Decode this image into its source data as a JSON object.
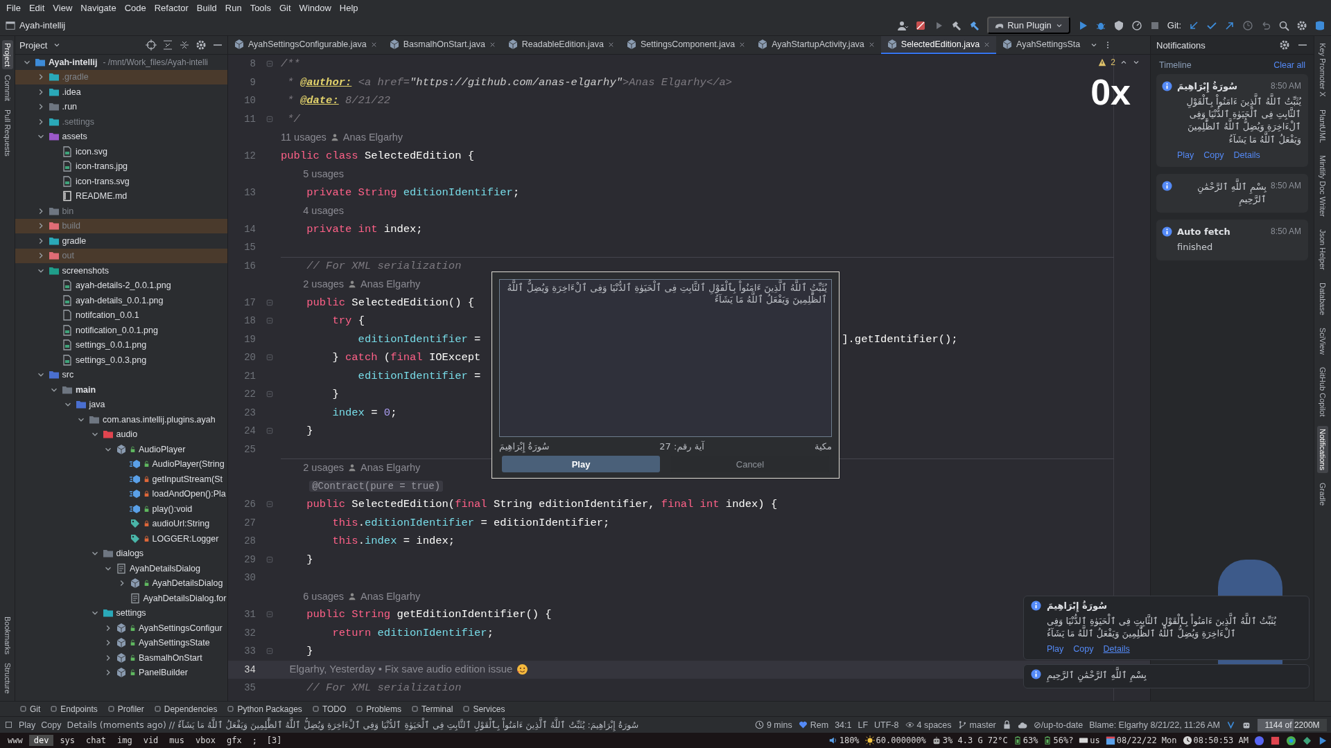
{
  "menu": [
    "File",
    "Edit",
    "View",
    "Navigate",
    "Code",
    "Refactor",
    "Build",
    "Run",
    "Tools",
    "Git",
    "Window",
    "Help"
  ],
  "toolbar": {
    "project": "Ayah-intellij",
    "run_config": "Run Plugin",
    "git_label": "Git:"
  },
  "left_tools": [
    {
      "label": "Project",
      "selected": true
    },
    {
      "label": "Commit",
      "selected": false
    },
    {
      "label": "Pull Requests",
      "selected": false
    }
  ],
  "left_tools_bottom": [
    {
      "label": "Bookmarks",
      "selected": false
    },
    {
      "label": "Structure",
      "selected": false
    }
  ],
  "project_panel": {
    "title": "Project",
    "tree": [
      {
        "label": "Ayah-intellij",
        "detail": "- /mnt/Work_files/Ayah-intelli",
        "kind": "module",
        "expanded": true,
        "children": [
          {
            "label": ".gradle",
            "kind": "excluded-config-folder",
            "expanded": false
          },
          {
            "label": ".idea",
            "kind": "config-folder",
            "expanded": false
          },
          {
            "label": ".run",
            "kind": "folder",
            "expanded": false
          },
          {
            "label": ".settings",
            "kind": "hidden-config-folder",
            "expanded": false
          },
          {
            "label": "assets",
            "kind": "resources-folder",
            "expanded": true,
            "children": [
              {
                "label": "icon.svg",
                "kind": "image-file"
              },
              {
                "label": "icon-trans.jpg",
                "kind": "image-file"
              },
              {
                "label": "icon-trans.svg",
                "kind": "image-file"
              },
              {
                "label": "README.md",
                "kind": "readme-file"
              }
            ]
          },
          {
            "label": "bin",
            "kind": "hidden-folder",
            "expanded": false
          },
          {
            "label": "build",
            "kind": "excluded-folder",
            "expanded": false
          },
          {
            "label": "gradle",
            "kind": "config-folder",
            "expanded": false
          },
          {
            "label": "out",
            "kind": "excluded-folder",
            "expanded": false
          },
          {
            "label": "screenshots",
            "kind": "images-folder",
            "expanded": true,
            "children": [
              {
                "label": "ayah-details-2_0.0.1.png",
                "kind": "image-file"
              },
              {
                "label": "ayah-details_0.0.1.png",
                "kind": "image-file"
              },
              {
                "label": "notifcation_0.0.1",
                "kind": "file"
              },
              {
                "label": "notification_0.0.1.png",
                "kind": "image-file"
              },
              {
                "label": "settings_0.0.1.png",
                "kind": "image-file"
              },
              {
                "label": "settings_0.0.3.png",
                "kind": "image-file"
              }
            ]
          },
          {
            "label": "src",
            "kind": "source-folder",
            "expanded": true,
            "children": [
              {
                "label": "main",
                "kind": "main-folder",
                "expanded": true,
                "children": [
                  {
                    "label": "java",
                    "kind": "java-folder",
                    "expanded": true,
                    "children": [
                      {
                        "label": "com.anas.intellij.plugins.ayah",
                        "kind": "package",
                        "expanded": true,
                        "children": [
                          {
                            "label": "audio",
                            "kind": "audio-package",
                            "expanded": true,
                            "children": [
                              {
                                "label": "AudioPlayer",
                                "kind": "class",
                                "private": false,
                                "expanded": true,
                                "children": [
                                  {
                                    "label": "AudioPlayer(String",
                                    "kind": "method",
                                    "private": false
                                  },
                                  {
                                    "label": "getInputStream(St",
                                    "kind": "method",
                                    "private": true
                                  },
                                  {
                                    "label": "loadAndOpen():Pla",
                                    "kind": "method",
                                    "private": true
                                  },
                                  {
                                    "label": "play():void",
                                    "kind": "method",
                                    "private": false
                                  },
                                  {
                                    "label": "audioUrl:String",
                                    "kind": "field",
                                    "private": true
                                  },
                                  {
                                    "label": "LOGGER:Logger",
                                    "kind": "field",
                                    "private": true
                                  }
                                ]
                              }
                            ]
                          },
                          {
                            "label": "dialogs",
                            "kind": "package",
                            "expanded": true,
                            "children": [
                              {
                                "label": "AyahDetailsDialog",
                                "kind": "form-group",
                                "expanded": true,
                                "children": [
                                  {
                                    "label": "AyahDetailsDialog",
                                    "kind": "class",
                                    "private": false,
                                    "expanded": false
                                  },
                                  {
                                    "label": "AyahDetailsDialog.for",
                                    "kind": "form-file"
                                  }
                                ]
                              }
                            ]
                          },
                          {
                            "label": "settings",
                            "kind": "settings-package",
                            "expanded": true,
                            "children": [
                              {
                                "label": "AyahSettingsConfigur",
                                "kind": "class",
                                "private": false,
                                "expanded": false
                              },
                              {
                                "label": "AyahSettingsState",
                                "kind": "class",
                                "private": false,
                                "expanded": false
                              },
                              {
                                "label": "BasmalhOnStart",
                                "kind": "class",
                                "private": false,
                                "expanded": false
                              },
                              {
                                "label": "PanelBuilder",
                                "kind": "class",
                                "private": false,
                                "expanded": false
                              }
                            ]
                          }
                        ]
                      }
                    ]
                  }
                ]
              }
            ]
          }
        ]
      }
    ]
  },
  "editor": {
    "tabs": [
      {
        "label": "AyahSettingsConfigurable.java",
        "selected": false,
        "closable": true
      },
      {
        "label": "BasmalhOnStart.java",
        "selected": false,
        "closable": true
      },
      {
        "label": "ReadableEdition.java",
        "selected": false,
        "closable": true
      },
      {
        "label": "SettingsComponent.java",
        "selected": false,
        "closable": true
      },
      {
        "label": "AyahStartupActivity.java",
        "selected": false,
        "closable": true
      },
      {
        "label": "SelectedEdition.java",
        "selected": true,
        "closable": true
      },
      {
        "label": "AyahSettingsSta",
        "selected": false,
        "closable": false
      }
    ],
    "warnings": "2",
    "overlay_text": "0x",
    "lines": [
      {
        "kind": "code",
        "number": "8",
        "fold": true,
        "current": false,
        "tokens": [
          {
            "kind": "comment",
            "text": "/**"
          }
        ]
      },
      {
        "kind": "code",
        "number": "9",
        "current": false,
        "tokens": [
          {
            "kind": "comment",
            "text": " * "
          },
          {
            "kind": "doctag",
            "text": "@author:"
          },
          {
            "kind": "comment",
            "text": " <a href="
          },
          {
            "kind": "docstr",
            "text": "\"https://github.com/anas-elgarhy\""
          },
          {
            "kind": "comment",
            "text": ">Anas Elgarhy</a>"
          }
        ]
      },
      {
        "kind": "code",
        "number": "10",
        "current": false,
        "tokens": [
          {
            "kind": "comment",
            "text": " * "
          },
          {
            "kind": "doctag",
            "text": "@date:"
          },
          {
            "kind": "comment",
            "text": " 8/21/22"
          }
        ]
      },
      {
        "kind": "code",
        "number": "11",
        "fold": true,
        "current": false,
        "tokens": [
          {
            "kind": "comment",
            "text": " */"
          }
        ]
      },
      {
        "kind": "hint",
        "usages": "11 usages",
        "author": "Anas Elgarhy"
      },
      {
        "kind": "code",
        "number": "12",
        "current": false,
        "tokens": [
          {
            "kind": "kw",
            "text": "public class "
          },
          {
            "kind": "plain",
            "text": "SelectedEdition {"
          }
        ]
      },
      {
        "kind": "hint",
        "usages": "5 usages"
      },
      {
        "kind": "code",
        "number": "13",
        "current": false,
        "tokens": [
          {
            "kind": "kw",
            "text": "    private String "
          },
          {
            "kind": "field",
            "text": "editionIdentifier"
          },
          {
            "kind": "plain",
            "text": ";"
          }
        ]
      },
      {
        "kind": "hint",
        "usages": "4 usages"
      },
      {
        "kind": "code",
        "number": "14",
        "current": false,
        "tokens": [
          {
            "kind": "kw",
            "text": "    private int "
          },
          {
            "kind": "plain",
            "text": "index;"
          }
        ]
      },
      {
        "kind": "code",
        "number": "15",
        "current": false
      },
      {
        "kind": "code",
        "number": "16",
        "separator": true,
        "current": false,
        "tokens": [
          {
            "kind": "comment",
            "text": "    // For XML serialization"
          }
        ]
      },
      {
        "kind": "hint",
        "usages": "2 usages",
        "author": "Anas Elgarhy"
      },
      {
        "kind": "code",
        "number": "17",
        "fold": true,
        "current": false,
        "tokens": [
          {
            "kind": "kw",
            "text": "    public "
          },
          {
            "kind": "plain",
            "text": "SelectedEdition() {"
          }
        ]
      },
      {
        "kind": "code",
        "number": "18",
        "fold": true,
        "current": false,
        "tokens": [
          {
            "kind": "kw",
            "text": "        try"
          },
          {
            "kind": "plain",
            "text": " {"
          }
        ]
      },
      {
        "kind": "code",
        "number": "19",
        "current": false,
        "tokens": [
          {
            "kind": "field",
            "text": "            editionIdentifier"
          },
          {
            "kind": "plain",
            "text": " ="
          },
          {
            "kind": "gap"
          },
          {
            "kind": "plain",
            "text": "].getIdentifier();"
          }
        ]
      },
      {
        "kind": "code",
        "number": "20",
        "fold": true,
        "current": false,
        "tokens": [
          {
            "kind": "plain",
            "text": "        } "
          },
          {
            "kind": "kw",
            "text": "catch"
          },
          {
            "kind": "plain",
            "text": " ("
          },
          {
            "kind": "kw",
            "text": "final "
          },
          {
            "kind": "plain",
            "text": "IOExcept"
          }
        ]
      },
      {
        "kind": "code",
        "number": "21",
        "current": false,
        "tokens": [
          {
            "kind": "field",
            "text": "            editionIdentifier"
          },
          {
            "kind": "plain",
            "text": " ="
          }
        ]
      },
      {
        "kind": "code",
        "number": "22",
        "fold": true,
        "current": false,
        "tokens": [
          {
            "kind": "plain",
            "text": "        }"
          }
        ]
      },
      {
        "kind": "code",
        "number": "23",
        "current": false,
        "tokens": [
          {
            "kind": "field",
            "text": "        index"
          },
          {
            "kind": "plain",
            "text": " = "
          },
          {
            "kind": "num",
            "text": "0"
          },
          {
            "kind": "plain",
            "text": ";"
          }
        ]
      },
      {
        "kind": "code",
        "number": "24",
        "fold": true,
        "current": false,
        "tokens": [
          {
            "kind": "plain",
            "text": "    }"
          }
        ]
      },
      {
        "kind": "code",
        "number": "25",
        "current": false
      },
      {
        "kind": "hint",
        "separator": true,
        "usages": "2 usages",
        "author": "Anas Elgarhy"
      },
      {
        "kind": "annotation",
        "text": "@Contract(pure = true)"
      },
      {
        "kind": "code",
        "number": "26",
        "fold": true,
        "current": false,
        "tokens": [
          {
            "kind": "kw",
            "text": "    public "
          },
          {
            "kind": "plain",
            "text": "SelectedEdition("
          },
          {
            "kind": "kw",
            "text": "final "
          },
          {
            "kind": "plain",
            "text": "String editionIdentifier, "
          },
          {
            "kind": "kw",
            "text": "final int "
          },
          {
            "kind": "plain",
            "text": "index) {"
          }
        ]
      },
      {
        "kind": "code",
        "number": "27",
        "current": false,
        "tokens": [
          {
            "kind": "kw",
            "text": "        this"
          },
          {
            "kind": "plain",
            "text": "."
          },
          {
            "kind": "field",
            "text": "editionIdentifier"
          },
          {
            "kind": "plain",
            "text": " = editionIdentifier;"
          }
        ]
      },
      {
        "kind": "code",
        "number": "28",
        "current": false,
        "tokens": [
          {
            "kind": "kw",
            "text": "        this"
          },
          {
            "kind": "plain",
            "text": "."
          },
          {
            "kind": "field",
            "text": "index"
          },
          {
            "kind": "plain",
            "text": " = index;"
          }
        ]
      },
      {
        "kind": "code",
        "number": "29",
        "fold": true,
        "current": false,
        "tokens": [
          {
            "kind": "plain",
            "text": "    }"
          }
        ]
      },
      {
        "kind": "code",
        "number": "30",
        "current": false
      },
      {
        "kind": "hint",
        "usages": "6 usages",
        "author": "Anas Elgarhy"
      },
      {
        "kind": "code",
        "number": "31",
        "fold": true,
        "current": false,
        "tokens": [
          {
            "kind": "kw",
            "text": "    public String "
          },
          {
            "kind": "plain",
            "text": "getEditionIdentifier() {"
          }
        ]
      },
      {
        "kind": "code",
        "number": "32",
        "current": false,
        "tokens": [
          {
            "kind": "kw",
            "text": "        return "
          },
          {
            "kind": "field",
            "text": "editionIdentifier"
          },
          {
            "kind": "plain",
            "text": ";"
          }
        ]
      },
      {
        "kind": "code",
        "number": "33",
        "fold": true,
        "current": false,
        "tokens": [
          {
            "kind": "plain",
            "text": "    }"
          }
        ]
      },
      {
        "kind": "code",
        "number": "34",
        "current": true,
        "tokens": [
          {
            "kind": "blame",
            "text": "   Elgarhy, Yesterday • Fix save audio edition issue"
          }
        ]
      },
      {
        "kind": "code",
        "number": "35",
        "current": false,
        "tokens": [
          {
            "kind": "comment",
            "text": "    // For XML serialization"
          }
        ]
      }
    ],
    "dialog": {
      "text": "يُثَبِّتُ ٱللَّهُ ٱلَّذِينَ ءَامَنُواْ بِٱلْقَوْلِ ٱلثَّابِتِ فِى ٱلْحَيَوٰةِ ٱلدُّنْيَا وَفِى ٱلْءَاخِرَةِ وَيُضِلُّ ٱللَّهُ ٱلظَّٰلِمِينَ وَيَفْعَلُ ٱللَّهُ مَا يَشَآءُ",
      "surah": "سُورَةُ إِبْرَاهِيمَ",
      "ayah_number": "آية رقم: 27",
      "revelation": "مكية",
      "buttons": [
        {
          "label": "Play",
          "selected": true
        },
        {
          "label": "Cancel",
          "selected": false
        }
      ]
    }
  },
  "notifications": {
    "title": "Notifications",
    "timeline": "Timeline",
    "clear": "Clear all",
    "items": [
      {
        "title": "سُورَةُ إِبْرَاهِيمَ",
        "time": "8:50 AM",
        "body": "يُثَبِّتُ ٱللَّهُ ٱلَّذِينَ ءَامَنُواْ بِٱلْقَوْلِ ٱلثَّابِتِ فِى ٱلْحَيَوٰةِ ٱلدُّنْيَا وَفِى ٱلْءَاخِرَةِ وَيُضِلُّ ٱللَّهُ ٱلظَّٰلِمِينَ وَيَفْعَلُ ٱللَّهُ مَا يَشَآءُ",
        "actions": [
          "Play",
          "Copy",
          "Details"
        ]
      },
      {
        "time": "8:50 AM",
        "body": "بِسْمِ ٱللَّهِ ٱلرَّحْمَٰنِ ٱلرَّحِيمِ"
      },
      {
        "title": "Auto fetch",
        "time": "8:50 AM",
        "body": "finished"
      }
    ]
  },
  "right_tools": [
    {
      "label": "Key Promoter X",
      "selected": false
    },
    {
      "label": "PlantUML",
      "selected": false
    },
    {
      "label": "Mintlify Doc Writer",
      "selected": false
    },
    {
      "label": "Json Helper",
      "selected": false
    },
    {
      "label": "Database",
      "selected": false
    },
    {
      "label": "SciView",
      "selected": false
    },
    {
      "label": "GitHub Copilot",
      "selected": false
    },
    {
      "label": "Notifications",
      "selected": true
    },
    {
      "label": "Gradle",
      "selected": false
    }
  ],
  "balloons": [
    {
      "title": "سُورَةُ إِبْرَاهِيمَ",
      "body": "يُثَبِّتُ ٱللَّهُ ٱلَّذِينَ ءَامَنُواْ بِٱلْقَوْلِ ٱلثَّابِتِ فِى ٱلْحَيَوٰةِ ٱلدُّنْيَا وَفِى ٱلْءَاخِرَةِ وَيُضِلُّ ٱللَّهُ ٱلظَّٰلِمِينَ وَيَفْعَلُ ٱللَّهُ مَا يَشَآءُ",
      "actions": [
        {
          "label": "Play",
          "hovered": false
        },
        {
          "label": "Copy",
          "hovered": false
        },
        {
          "label": "Details",
          "hovered": true
        }
      ]
    },
    {
      "body": "بِسْمِ ٱللَّهِ ٱلرَّحْمَٰنِ ٱلرَّحِيمِ"
    }
  ],
  "tool_windows": [
    "Git",
    "Endpoints",
    "Profiler",
    "Dependencies",
    "Python Packages",
    "TODO",
    "Problems",
    "Terminal",
    "Services"
  ],
  "status_bar": {
    "actions": [
      "Play",
      "Copy"
    ],
    "message": "Details (moments ago) // سُورَةُ إِبْرَاهِيمَ: يُثَبِّتُ ٱللَّهُ ٱلَّذِينَ ءَامَنُواْ بِٱلْقَوْلِ ٱلثَّابِتِ فِى ٱلْحَيَوٰةِ ٱلدُّنْيَا وَفِى ٱلْءَاخِرَةِ وَيُضِلُّ ٱللَّهُ ٱلظَّٰلِمِينَ وَيَفْعَلُ ٱللَّهُ مَا يَشَآءُ",
    "items": [
      {
        "kind": "clock",
        "text": "9 mins"
      },
      {
        "kind": "heart",
        "text": "Rem"
      },
      {
        "kind": "plain",
        "text": "34:1"
      },
      {
        "kind": "plain",
        "text": "LF"
      },
      {
        "kind": "plain",
        "text": "UTF-8"
      },
      {
        "kind": "eye",
        "text": "4 spaces"
      },
      {
        "kind": "branch",
        "text": "master"
      },
      {
        "kind": "lock"
      },
      {
        "kind": "cloud"
      },
      {
        "kind": "plain",
        "text": "⊘/up-to-date"
      },
      {
        "kind": "plain",
        "text": "Blame: Elgarhy 8/21/22, 11:26 AM"
      }
    ],
    "memory": {
      "text": "1144 of 2200M",
      "level": 0.52
    }
  },
  "system_bar": {
    "workspaces": [
      {
        "label": "www",
        "selected": false
      },
      {
        "label": "dev",
        "selected": true
      },
      {
        "label": "sys",
        "selected": false
      },
      {
        "label": "chat",
        "selected": false
      },
      {
        "label": "img",
        "selected": false
      },
      {
        "label": "vid",
        "selected": false
      },
      {
        "label": "mus",
        "selected": false
      },
      {
        "label": "vbox",
        "selected": false
      },
      {
        "label": "gfx",
        "selected": false
      }
    ],
    "separator": ";",
    "layout": "[3]",
    "indicators": [
      {
        "kind": "speaker",
        "text": "180%"
      },
      {
        "kind": "sun",
        "text": "60.000000%"
      },
      {
        "kind": "chip",
        "text": "3% 4.3 G 72°C"
      },
      {
        "kind": "battery",
        "text": "63%"
      },
      {
        "kind": "battery",
        "text": "56%?"
      },
      {
        "kind": "keyboard",
        "text": "us"
      },
      {
        "kind": "calendar",
        "text": "08/22/22 Mon"
      },
      {
        "kind": "clock",
        "text": "08:50:53 AM"
      }
    ]
  }
}
